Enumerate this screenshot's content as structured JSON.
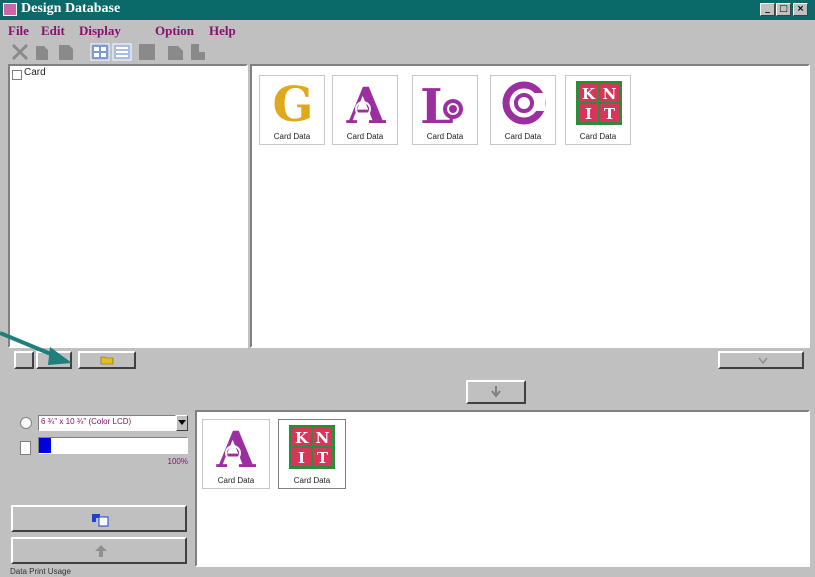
{
  "window": {
    "title": "Design Database",
    "controls": [
      "_",
      "□",
      "×"
    ]
  },
  "menu": [
    {
      "label": "File"
    },
    {
      "label": "Edit"
    },
    {
      "label": "Display"
    },
    {
      "label": "Option"
    },
    {
      "label": "Help"
    }
  ],
  "toolbar": {
    "icons": [
      "cut-icon",
      "copy-icon",
      "paste-icon",
      "large-icons-view-icon",
      "list-view-icon",
      "delete-icon",
      "move-up-icon",
      "move-down-icon"
    ]
  },
  "tree": {
    "root_label": "Card"
  },
  "gallery": {
    "items": [
      {
        "glyph": "G",
        "caption": "Card Data"
      },
      {
        "glyph": "A",
        "caption": "Card Data"
      },
      {
        "glyph": "L",
        "caption": "Card Data"
      },
      {
        "glyph": "C",
        "caption": "Card Data"
      },
      {
        "glyph": "KNIT",
        "caption": "Card Data"
      }
    ]
  },
  "basket": {
    "items": [
      {
        "glyph": "A",
        "caption": "Card Data"
      },
      {
        "glyph": "KNIT",
        "caption": "Card Data"
      }
    ]
  },
  "controls": {
    "media_select": "6 ¾\" x 10 ¾\" (Color LCD)",
    "progress_label": "100%",
    "progress_fraction": 0.08
  },
  "status": {
    "text": "Data Print Usage"
  },
  "colors": {
    "title_bar": "#0a6a6a",
    "menu_text": "#8a0f6e",
    "glyph_purple": "#9b2fa0",
    "glyph_gold": "#e0a81c",
    "knit_red": "#d8355a",
    "knit_green": "#2e8b3a",
    "pointer_arrow": "#1f7f7a"
  }
}
